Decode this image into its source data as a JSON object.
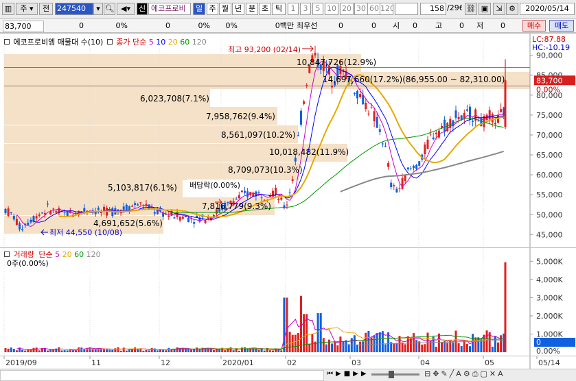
{
  "toolbar": {
    "period_label": "주",
    "prev_label": "전",
    "code": "247540",
    "badge": "신",
    "stock_name": "에코프로비",
    "period_tabs": [
      "일",
      "주",
      "월",
      "년",
      "분",
      "초",
      "틱"
    ],
    "period_nums": [
      "1",
      "3",
      "5",
      "10",
      "20",
      "30",
      "60",
      "120"
    ],
    "page_counter": "158",
    "page_total": "/296",
    "date": "2020/05/14"
  },
  "quote_bar": {
    "price": "83,700",
    "f1": "0",
    "f2": "0%",
    "f3": "0",
    "f4": "0%",
    "f5_label": "0백만",
    "priority_label": "최우선",
    "f6": "0",
    "f7": "0",
    "open_label": "시",
    "open_val": "0",
    "high_label": "고",
    "high_val": "0",
    "low_label": "저",
    "low_val": "0",
    "buy_label": "매수",
    "sell_label": "매도"
  },
  "price_pane": {
    "title": "에코프로비엠 매물대 수(10)",
    "ma_label": "종가 단순",
    "ma_periods": [
      {
        "label": "5",
        "color": "#cc00cc"
      },
      {
        "label": "10",
        "color": "#0000ff"
      },
      {
        "label": "20",
        "color": "#e6a800"
      },
      {
        "label": "60",
        "color": "#009900"
      },
      {
        "label": "120",
        "color": "#888888"
      }
    ],
    "lc": "LC:87.88",
    "hc": "HC:-10.19",
    "current_price": "83,700",
    "current_pct": "0.00%",
    "high_note": "최고 93,200 (02/14)",
    "low_note": "최저 44,550 (10/08)",
    "dividend_note": "배당락(0.00%)",
    "y_ticks": [
      "90,000",
      "85,000",
      "80,000",
      "75,000",
      "70,000",
      "65,000",
      "60,000",
      "55,000",
      "50,000",
      "45,000"
    ],
    "volume_profile": [
      "14,697,660(17.2%)(86,955.00 ~ 82,310.00)",
      "10,847,726(12.9%)",
      "6,023,708(7.1%)",
      "7,958,762(9.4%)",
      "8,561,097(10.2%)",
      "10,018,482(11.9%)",
      "8,709,073(10.3%)",
      "5,103,817(6.1%)",
      "7,816,779(9.3%)",
      "4,691,652(5.6%)"
    ]
  },
  "volume_pane": {
    "title": "거래량",
    "ma_label": "단순",
    "ma_periods": [
      {
        "label": "5",
        "color": "#cc00cc"
      },
      {
        "label": "20",
        "color": "#e6a800"
      },
      {
        "label": "60",
        "color": "#009900"
      },
      {
        "label": "120",
        "color": "#888888"
      }
    ],
    "sub_label": "0주(0.00%)",
    "y_ticks": [
      "5,000K",
      "4,000K",
      "3,000K",
      "2,000K",
      "1,000K",
      "0.00%"
    ],
    "current_value": "0"
  },
  "x_axis": {
    "labels": [
      "2019/09",
      "11",
      "12",
      "2020/01",
      "02",
      "03",
      "04",
      "05",
      "05/14"
    ]
  },
  "colors": {
    "up": "#e02020",
    "down": "#1060e0",
    "profile": "#f5e1c8",
    "accent": "#2a56c6"
  },
  "icons": [
    "search-icon",
    "speaker-icon",
    "chevron-down-icon",
    "link-icon",
    "save-icon",
    "gear-icon",
    "play-icon",
    "stop-icon",
    "zoom-icon"
  ]
}
